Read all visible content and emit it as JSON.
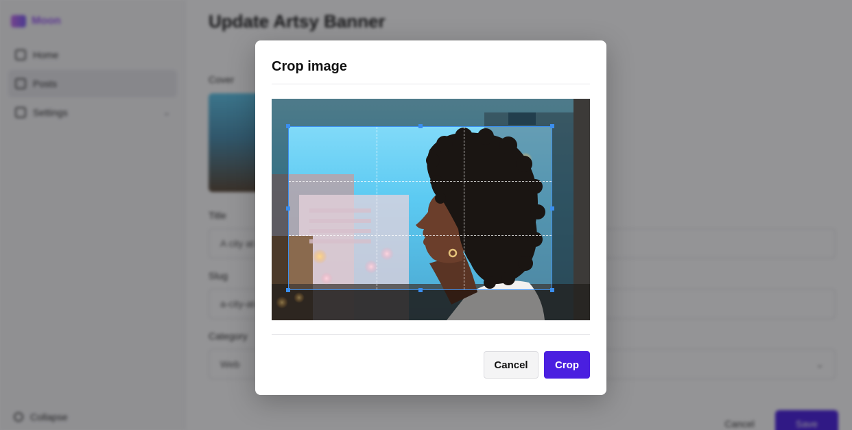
{
  "background": {
    "logo_text": "Moon",
    "nav": [
      {
        "label": "Home",
        "icon": "home-icon"
      },
      {
        "label": "Posts",
        "icon": "posts-icon"
      },
      {
        "label": "Settings",
        "icon": "settings-icon"
      }
    ],
    "sidebar_footer": "Collapse",
    "page_title": "Update Artsy Banner",
    "fields": {
      "cover_label": "Cover",
      "title_label": "Title",
      "title_value": "A city at dusk",
      "slug_label": "Slug",
      "slug_value": "a-city-at-dusk",
      "category_label": "Category",
      "category_value": "Web"
    },
    "buttons": {
      "secondary": "Cancel",
      "primary": "Save"
    }
  },
  "modal": {
    "title": "Crop image",
    "cancel_label": "Cancel",
    "crop_label": "Crop",
    "accent_color": "#4a1fe0",
    "crop_frame_color": "#3b8ff0"
  }
}
